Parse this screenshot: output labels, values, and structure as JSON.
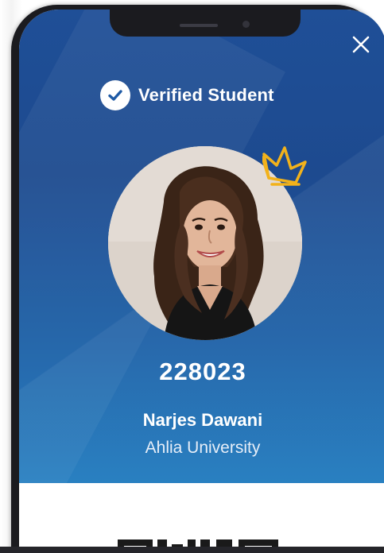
{
  "header": {
    "verified_label": "Verified Student",
    "check_icon": "check-circle-icon",
    "close_icon": "close-icon",
    "crown_icon": "crown-icon"
  },
  "student": {
    "id": "228023",
    "name": "Narjes Dawani",
    "university": "Ahlia University",
    "photo": "student-photo"
  },
  "qr": {
    "icon": "qr-code-icon"
  },
  "colors": {
    "hero_top": "#1f4f97",
    "hero_bottom": "#1c78bd",
    "crown": "#f2b21b",
    "text": "#ffffff"
  }
}
